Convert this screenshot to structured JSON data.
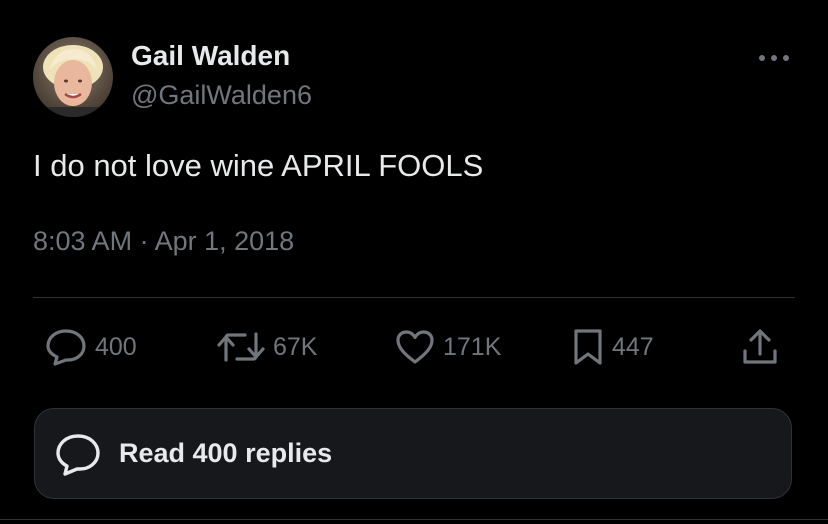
{
  "tweet": {
    "author": {
      "display_name": "Gail Walden",
      "handle": "@GailWalden6",
      "avatar_icon": "profile-photo"
    },
    "text": "I do not love wine APRIL FOOLS",
    "timestamp": "8:03 AM · Apr 1, 2018",
    "more_icon": "more-horizontal-icon"
  },
  "actions": {
    "reply": {
      "icon": "reply-icon",
      "count": "400"
    },
    "retweet": {
      "icon": "retweet-icon",
      "count": "67K"
    },
    "like": {
      "icon": "heart-icon",
      "count": "171K"
    },
    "bookmark": {
      "icon": "bookmark-icon",
      "count": "447"
    },
    "share": {
      "icon": "share-icon"
    }
  },
  "replies_button": {
    "icon": "reply-bubble-icon",
    "label": "Read 400 replies"
  },
  "colors": {
    "background": "#000000",
    "primary_text": "#e7e9ea",
    "secondary_text": "#71767b",
    "divider": "#2f3336",
    "button_bg": "#16181c"
  }
}
